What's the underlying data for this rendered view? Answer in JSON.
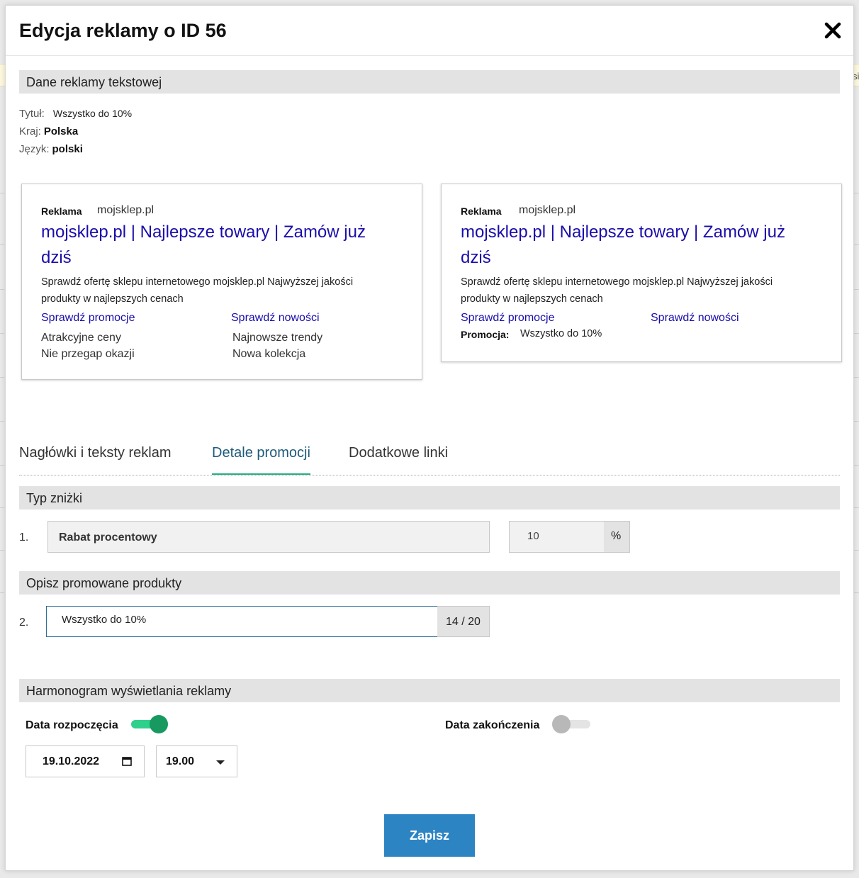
{
  "modal": {
    "title": "Edycja reklamy o ID 56"
  },
  "background": {
    "strip_text": "si"
  },
  "text_ad_section": {
    "heading": "Dane reklamy tekstowej",
    "title_label": "Tytuł:",
    "title_value": "Wszystko do 10%",
    "country_label": "Kraj:",
    "country_value": "Polska",
    "language_label": "Język:",
    "language_value": "polski"
  },
  "previews": [
    {
      "tag": "Reklama",
      "domain": "mojsklep.pl",
      "headline": "mojsklep.pl | Najlepsze towary  | Zamów już dziś",
      "description": "Sprawdź ofertę sklepu internetowego mojsklep.pl  Najwyższej jakości produkty w najlepszych cenach",
      "link1": "Sprawdź promocje",
      "link2": "Sprawdź nowości",
      "link1_line1": "Atrakcyjne ceny",
      "link1_line2": "Nie przegap okazji",
      "link2_line1": "Najnowsze trendy",
      "link2_line2": "Nowa kolekcja"
    },
    {
      "tag": "Reklama",
      "domain": "mojsklep.pl",
      "headline": "mojsklep.pl | Najlepsze towary  | Zamów już dziś",
      "description": "Sprawdź ofertę sklepu internetowego mojsklep.pl  Najwyższej jakości produkty w najlepszych cenach",
      "link1": "Sprawdź promocje",
      "link2": "Sprawdź nowości",
      "promo_label": "Promocja:",
      "promo_value": "Wszystko do 10%"
    }
  ],
  "tabs": [
    {
      "label": "Nagłówki i teksty reklam",
      "active": false
    },
    {
      "label": "Detale promocji",
      "active": true
    },
    {
      "label": "Dodatkowe linki",
      "active": false
    }
  ],
  "discount_section": {
    "heading": "Typ zniżki",
    "row_number": "1.",
    "type_value": "Rabat procentowy",
    "amount_value": "10",
    "amount_suffix": "%"
  },
  "products_section": {
    "heading": "Opisz promowane produkty",
    "row_number": "2.",
    "input_value": "Wszystko do 10%",
    "counter": "14 / 20"
  },
  "schedule_section": {
    "heading": "Harmonogram wyświetlania reklamy",
    "start_label": "Data rozpoczęcia",
    "start_enabled": true,
    "end_label": "Data zakończenia",
    "end_enabled": false,
    "start_date": "19.10.2022",
    "start_time": "19.00"
  },
  "actions": {
    "save_label": "Zapisz"
  },
  "colors": {
    "accent_green": "#22b07d",
    "toggle_on_knob": "#17995f",
    "toggle_on_track": "#2fcf8c",
    "toggle_off_knob": "#b8b8b8",
    "toggle_off_track": "#e4e4e4",
    "link_blue": "#1a0dab",
    "primary_button": "#2d84c3"
  }
}
